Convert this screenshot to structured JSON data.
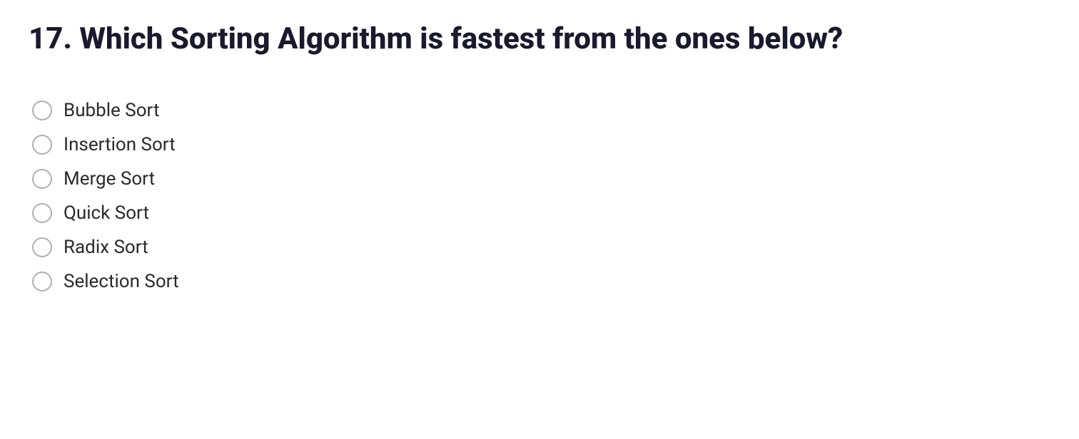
{
  "question": {
    "title": "17. Which Sorting Algorithm is fastest from the ones below?",
    "options": [
      {
        "id": "bubble-sort",
        "label": "Bubble Sort"
      },
      {
        "id": "insertion-sort",
        "label": "Insertion Sort"
      },
      {
        "id": "merge-sort",
        "label": "Merge Sort"
      },
      {
        "id": "quick-sort",
        "label": "Quick Sort"
      },
      {
        "id": "radix-sort",
        "label": "Radix Sort"
      },
      {
        "id": "selection-sort",
        "label": "Selection Sort"
      }
    ]
  }
}
